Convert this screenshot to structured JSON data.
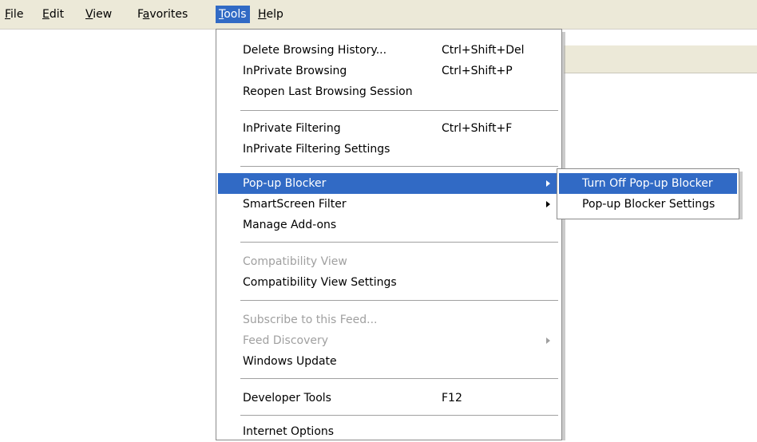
{
  "menubar": {
    "items": [
      {
        "pre": "",
        "key": "F",
        "post": "ile"
      },
      {
        "pre": "",
        "key": "E",
        "post": "dit"
      },
      {
        "pre": "",
        "key": "V",
        "post": "iew"
      },
      {
        "pre": "F",
        "key": "a",
        "post": "vorites"
      },
      {
        "pre": "",
        "key": "T",
        "post": "ools"
      },
      {
        "pre": "",
        "key": "H",
        "post": "elp"
      }
    ]
  },
  "tools_menu": {
    "items": [
      {
        "label": "Delete Browsing History...",
        "shortcut": "Ctrl+Shift+Del"
      },
      {
        "label": "InPrivate Browsing",
        "shortcut": "Ctrl+Shift+P"
      },
      {
        "label": "Reopen Last Browsing Session"
      },
      {
        "label": "InPrivate Filtering",
        "shortcut": "Ctrl+Shift+F"
      },
      {
        "label": "InPrivate Filtering Settings"
      },
      {
        "label": "Pop-up Blocker",
        "submenu": true,
        "highlighted": true
      },
      {
        "label": "SmartScreen Filter",
        "submenu": true
      },
      {
        "label": "Manage Add-ons"
      },
      {
        "label": "Compatibility View",
        "disabled": true
      },
      {
        "label": "Compatibility View Settings"
      },
      {
        "label": "Subscribe to this Feed...",
        "disabled": true
      },
      {
        "label": "Feed Discovery",
        "submenu": true,
        "disabled": true
      },
      {
        "label": "Windows Update"
      },
      {
        "label": "Developer Tools",
        "shortcut": "F12"
      },
      {
        "label": "Internet Options"
      }
    ]
  },
  "popup_submenu": {
    "items": [
      {
        "label": "Turn Off Pop-up Blocker",
        "highlighted": true
      },
      {
        "label": "Pop-up Blocker Settings"
      }
    ]
  },
  "colors": {
    "highlight": "#316ac5",
    "menubar_bg": "#ece9d8",
    "disabled_text": "#a0a0a0"
  }
}
